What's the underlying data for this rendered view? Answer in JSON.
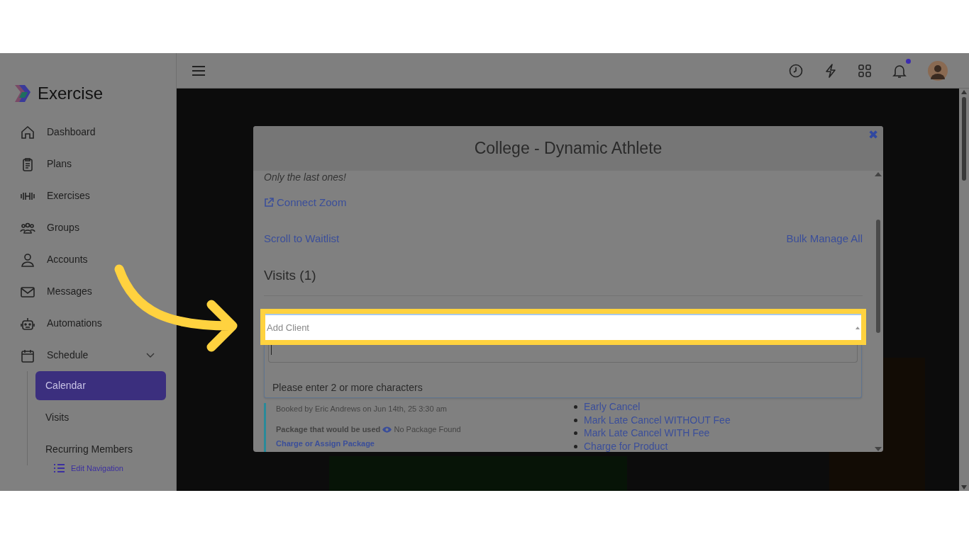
{
  "app": {
    "name": "Exercise"
  },
  "sidebar": {
    "items": [
      {
        "label": "Dashboard",
        "selected": false
      },
      {
        "label": "Plans",
        "selected": false
      },
      {
        "label": "Exercises",
        "selected": false
      },
      {
        "label": "Groups",
        "selected": false
      },
      {
        "label": "Accounts",
        "selected": false
      },
      {
        "label": "Messages",
        "selected": false
      },
      {
        "label": "Automations",
        "selected": false
      },
      {
        "label": "Schedule",
        "selected": false,
        "expanded": true,
        "children": [
          {
            "label": "Calendar",
            "selected": true
          },
          {
            "label": "Visits",
            "selected": false
          },
          {
            "label": "Recurring Members",
            "selected": false
          }
        ]
      }
    ],
    "edit_navigation": "Edit Navigation"
  },
  "topbar": {
    "notification_dot": true
  },
  "modal": {
    "title": "College - Dynamic Athlete",
    "close": "✖",
    "note": "Only the last ones!",
    "connect_link": "Connect Zoom",
    "scroll_link": "Scroll to Waitlist",
    "bulk_link": "Bulk Manage All",
    "visits_heading": "Visits (1)",
    "add_client": {
      "placeholder": "Add Client"
    },
    "dropdown_message": "Please enter 2 or more characters",
    "visit": {
      "booked_by": "Booked by Eric Andrews on Jun 14th, 25 3:30 am",
      "package_label": "Package that would be used",
      "package_value": "No Package Found",
      "package_link": "Charge or Assign Package",
      "actions": [
        "Early Cancel",
        "Mark Late Cancel WITHOUT Fee",
        "Mark Late Cancel WITH Fee",
        "Charge for Product"
      ]
    }
  }
}
